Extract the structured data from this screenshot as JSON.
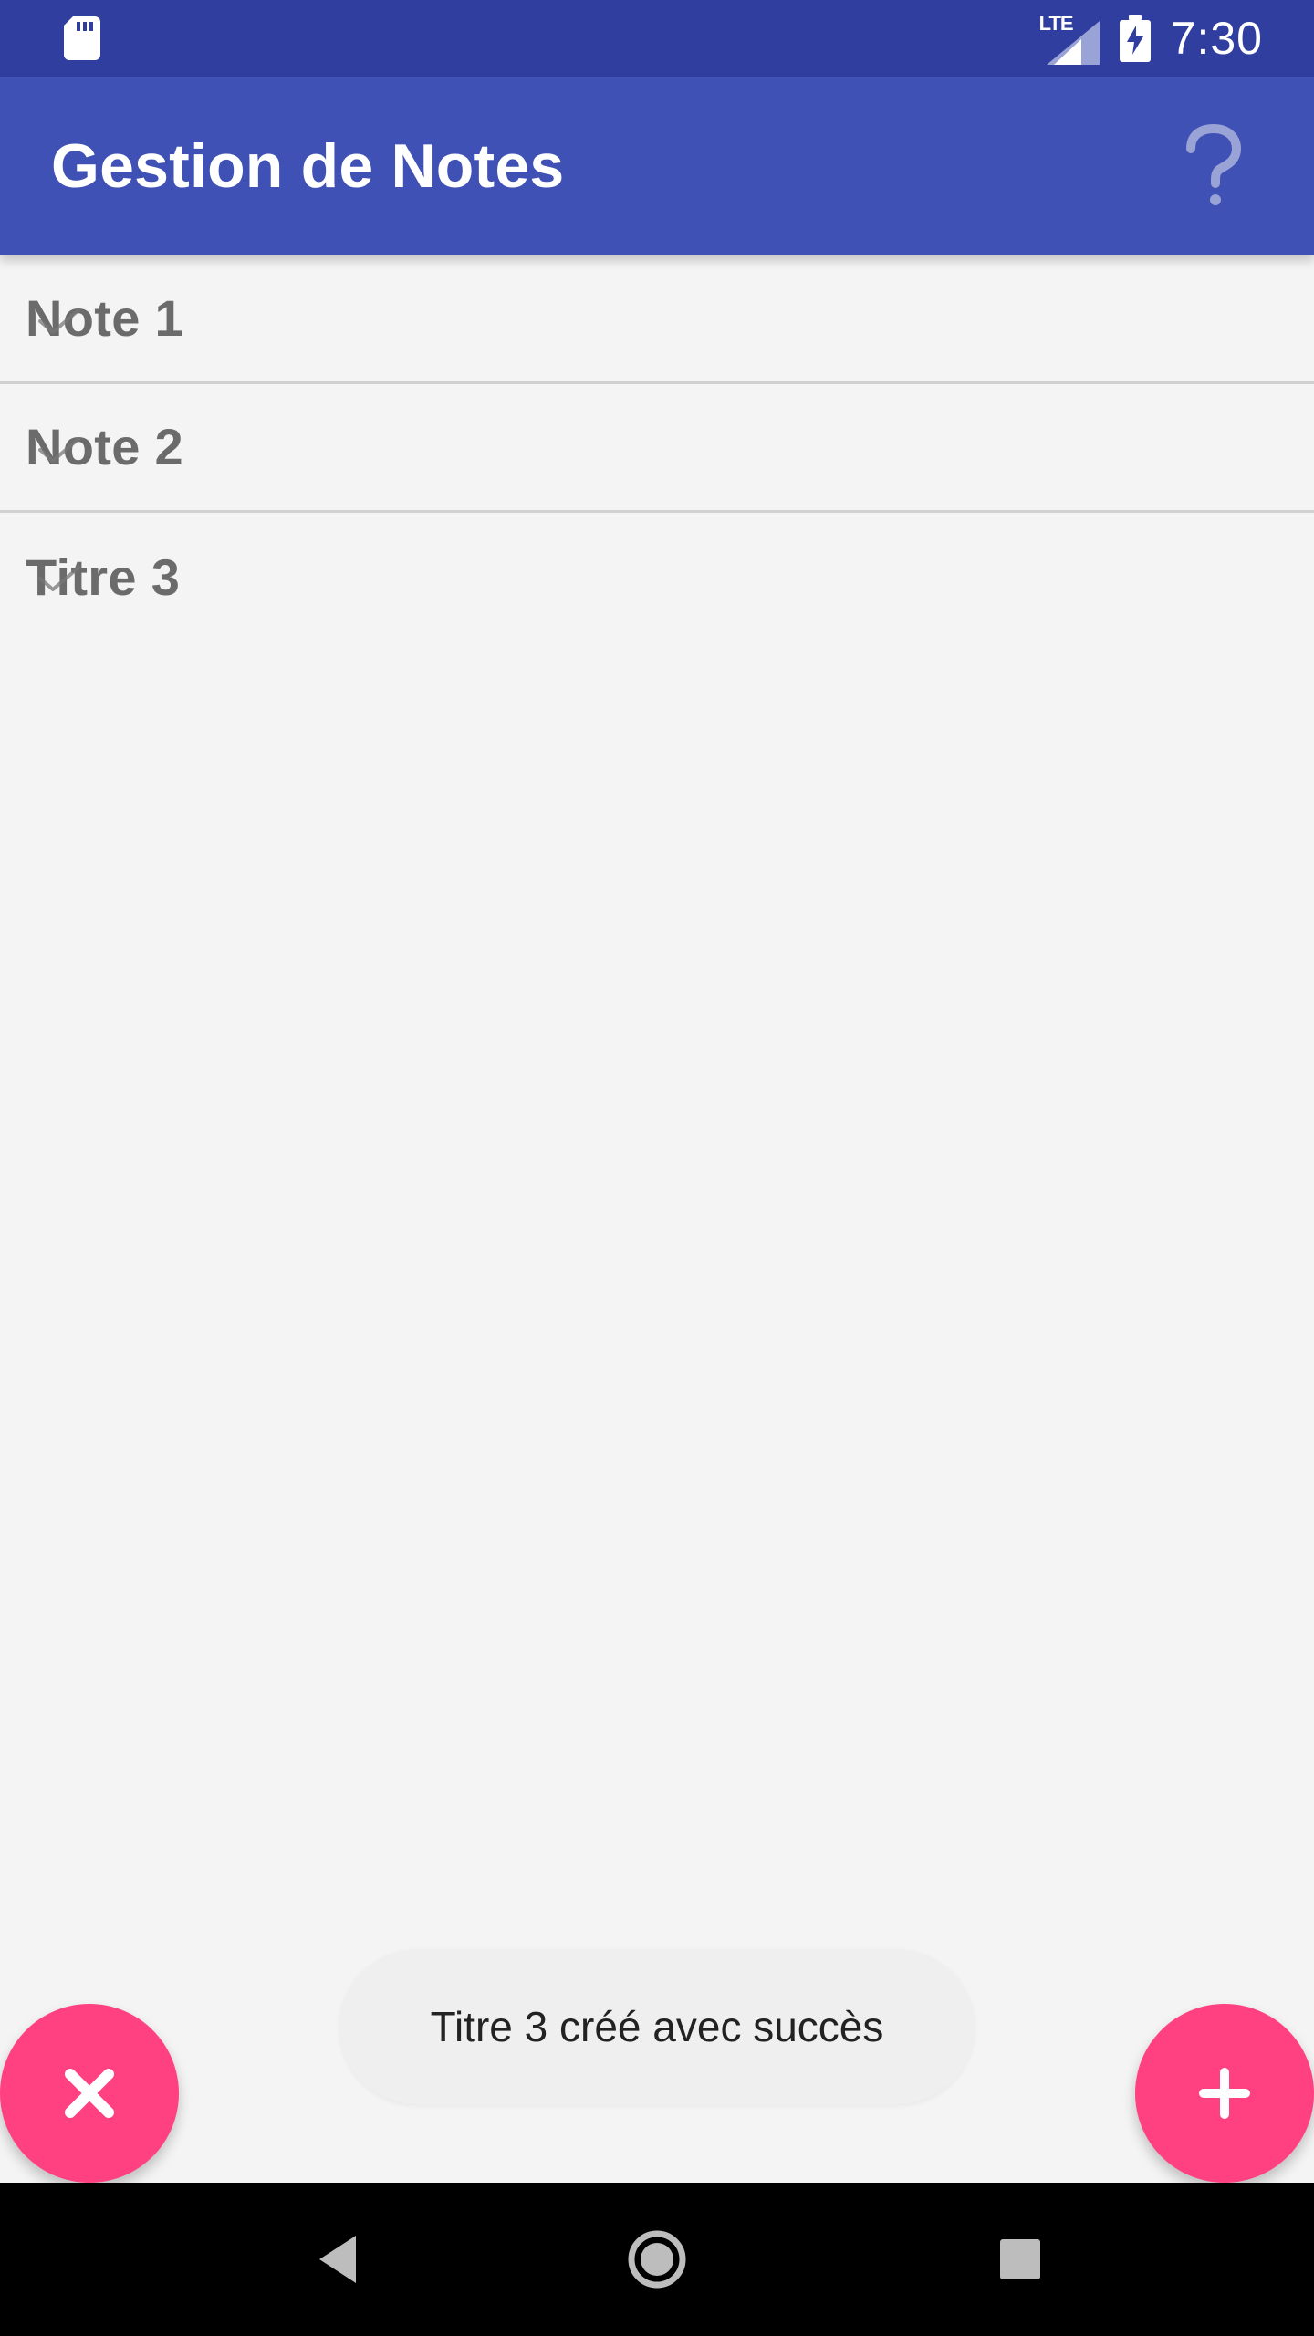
{
  "status_bar": {
    "lte_label": "LTE",
    "time": "7:30",
    "icons": {
      "left": "sd-card-icon",
      "signal": "signal-icon",
      "battery": "battery-charging-icon"
    },
    "colors": {
      "background": "#303F9F"
    }
  },
  "app_bar": {
    "title": "Gestion de Notes",
    "help_icon": "help-question-icon",
    "colors": {
      "background": "#3F51B5"
    }
  },
  "notes": {
    "items": [
      {
        "title": "Note 1",
        "icon": "check-icon"
      },
      {
        "title": "Note 2",
        "icon": "check-icon"
      },
      {
        "title": "Titre 3",
        "icon": "check-icon"
      }
    ]
  },
  "toast": {
    "message": "Titre 3 créé avec succès"
  },
  "fabs": {
    "left_icon": "close-icon",
    "right_icon": "plus-icon",
    "color": "#FF4081"
  },
  "navigation_bar": {
    "back_icon": "back-icon",
    "home_icon": "home-icon",
    "recents_icon": "recents-icon"
  }
}
